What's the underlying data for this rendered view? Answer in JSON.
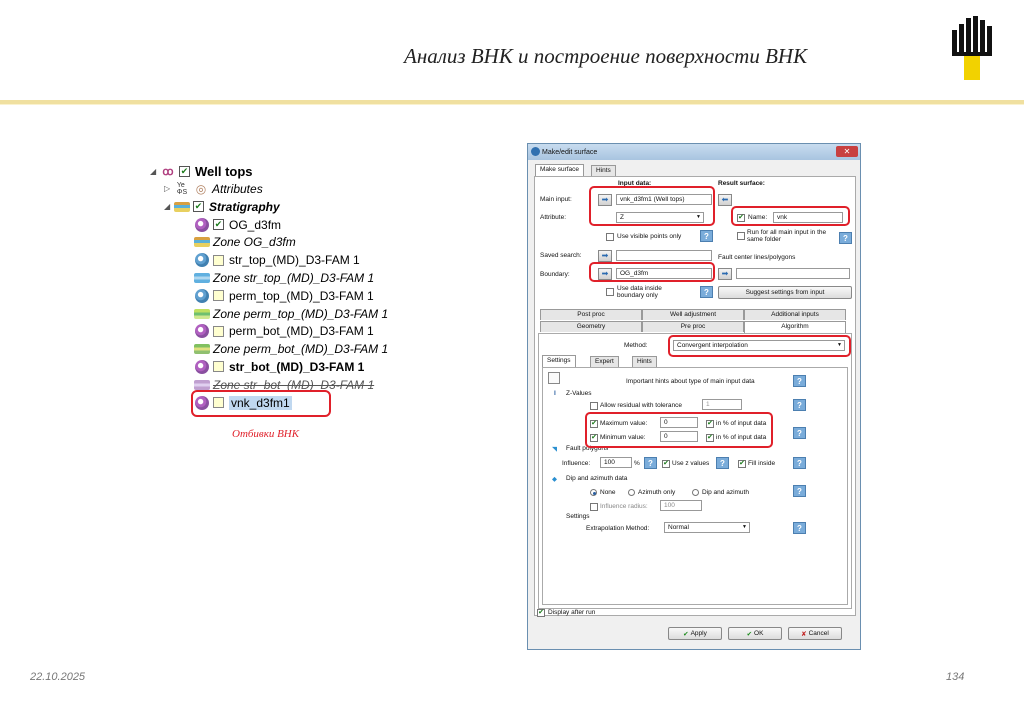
{
  "slide": {
    "title": "Анализ ВНК и построение поверхности ВНК",
    "date": "22.10.2025",
    "page": "134",
    "caption": "Отбивки ВНК"
  },
  "tree": {
    "root": "Well tops",
    "attributes": "Attributes",
    "stratigraphy": "Stratigraphy",
    "items": [
      {
        "label": "OG_d3fm",
        "type": "poly",
        "checked": true
      },
      {
        "label": "Zone OG_d3fm",
        "type": "zone"
      },
      {
        "label": "str_top_(MD)_D3-FAM 1",
        "type": "poly"
      },
      {
        "label": "Zone str_top_(MD)_D3-FAM 1",
        "type": "zone"
      },
      {
        "label": "perm_top_(MD)_D3-FAM 1",
        "type": "poly"
      },
      {
        "label": "Zone perm_top_(MD)_D3-FAM 1",
        "type": "zone"
      },
      {
        "label": "perm_bot_(MD)_D3-FAM 1",
        "type": "poly"
      },
      {
        "label": "Zone perm_bot_(MD)_D3-FAM 1",
        "type": "zone"
      },
      {
        "label": "str_bot_(MD)_D3-FAM 1",
        "type": "poly"
      },
      {
        "label": "Zone str_bot_(MD)_D3-FAM 1",
        "type": "zone"
      },
      {
        "label": "vnk_d3fm1",
        "type": "poly"
      }
    ]
  },
  "dialog": {
    "title": "Make/edit surface",
    "tabs": [
      "Make surface",
      "Hints"
    ],
    "input_data": "Input data:",
    "result_surface": "Result surface:",
    "main_input_label": "Main input:",
    "main_input_value": "vnk_d3fm1 (Well tops)",
    "attribute_label": "Attribute:",
    "attribute_value": "Z",
    "use_visible_points": "Use visible points only",
    "name_label": "Name:",
    "name_value": "vnk",
    "run_for_all": "Run for all main input in the same folder",
    "saved_search": "Saved search:",
    "fault_center": "Fault center lines/polygons",
    "boundary_label": "Boundary:",
    "boundary_value": "OG_d3fm",
    "use_data_inside": "Use data inside boundary only",
    "suggest_btn": "Suggest settings from input",
    "tabs2": [
      "Post proc",
      "Well adjustment",
      "Additional inputs",
      "Geometry",
      "Pre proc",
      "Algorithm"
    ],
    "method_label": "Method:",
    "method_value": "Convergent interpolation",
    "subtabs": [
      "Settings",
      "Expert",
      "Hints"
    ],
    "hints_text": "Important hints about type of main input data",
    "z_values": "Z-Values",
    "allow_residual": "Allow residual with tolerance",
    "tolerance": "1",
    "max_label": "Maximum value:",
    "max_value": "0",
    "min_label": "Minimum value:",
    "min_value": "0",
    "pct_input": "in % of input data",
    "fault_polygons": "Fault polygons",
    "influence_label": "Influence:",
    "influence_value": "100",
    "pct": "%",
    "use_z": "Use z values",
    "fill_inside": "Fill inside",
    "dip_azimuth": "Dip and azimuth data",
    "opt_none": "None",
    "opt_azimuth": "Azimuth only",
    "opt_dip": "Dip and azimuth",
    "influence_radius": "Influence radius:",
    "radius_value": "100",
    "settings": "Settings",
    "extrap_label": "Extrapolation Method:",
    "extrap_value": "Normal",
    "display_after": "Display after run",
    "apply": "Apply",
    "ok": "OK",
    "cancel": "Cancel",
    "help": "?"
  },
  "colors": {
    "accent": "#f0e0a0",
    "highlight": "#e0202a"
  }
}
